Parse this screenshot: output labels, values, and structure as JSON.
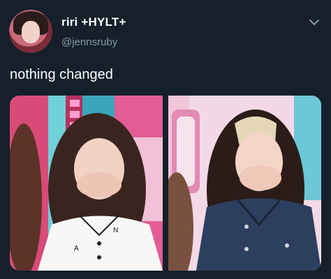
{
  "tweet": {
    "display_name": "riri +HYLT+",
    "handle": "@jennsruby",
    "text": "nothing changed",
    "menu_icon": "chevron-down-icon",
    "avatar_icon": "profile-avatar"
  },
  "media": [
    {
      "description_icon": "photo-left"
    },
    {
      "description_icon": "photo-right"
    }
  ],
  "colors": {
    "background": "#15202b",
    "text_primary": "#ffffff",
    "text_secondary": "#8899a6"
  }
}
